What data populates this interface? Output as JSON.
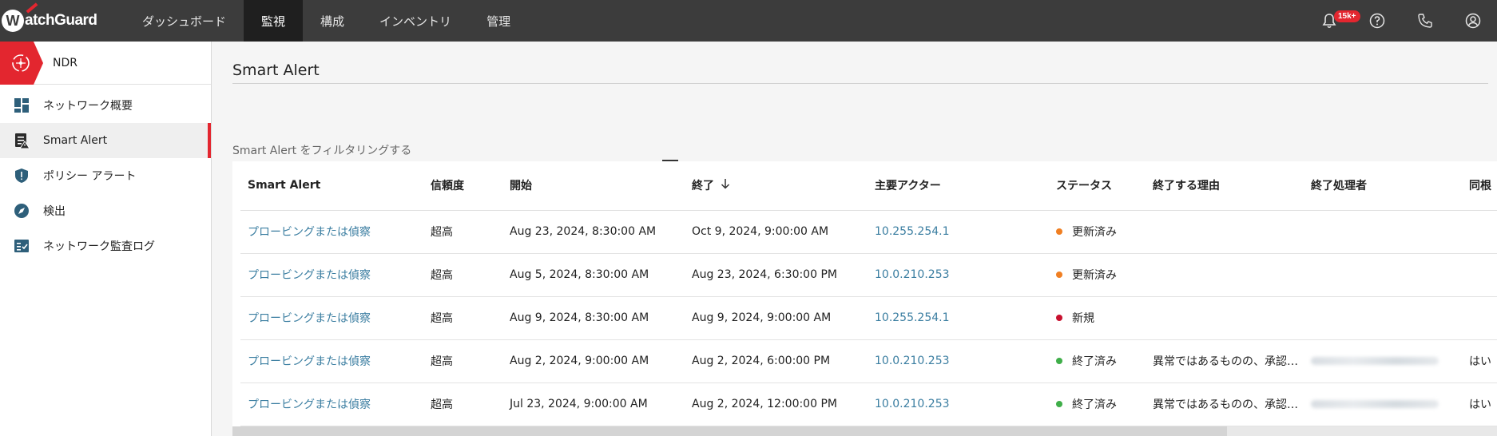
{
  "brand": {
    "logo_letter": "W",
    "logo_text": "atchGuard"
  },
  "nav": [
    {
      "label": "ダッシュボード",
      "active": false
    },
    {
      "label": "監視",
      "active": true
    },
    {
      "label": "構成",
      "active": false
    },
    {
      "label": "インベントリ",
      "active": false
    },
    {
      "label": "管理",
      "active": false
    }
  ],
  "topbar": {
    "notifications_badge": "15k+"
  },
  "sidebar": {
    "header": "NDR",
    "items": [
      {
        "label": "ネットワーク概要",
        "icon": "dashboard-icon",
        "active": false
      },
      {
        "label": "Smart Alert",
        "icon": "alert-list-icon",
        "active": true
      },
      {
        "label": "ポリシー アラート",
        "icon": "shield-icon",
        "active": false
      },
      {
        "label": "検出",
        "icon": "compass-icon",
        "active": false
      },
      {
        "label": "ネットワーク監査ログ",
        "icon": "audit-log-icon",
        "active": false
      }
    ]
  },
  "main": {
    "title": "Smart Alert",
    "filter": {
      "placeholder": "Smart Alert をフィルタリングする"
    }
  },
  "table": {
    "columns": [
      "Smart Alert",
      "信頼度",
      "開始",
      "終了",
      "主要アクター",
      "ステータス",
      "終了する理由",
      "終了処理者",
      "同根"
    ],
    "sort_column": "終了",
    "sort_direction": "desc",
    "rows": [
      {
        "alert": "プロービングまたは偵察",
        "confidence": "超高",
        "start": "Aug 23, 2024, 8:30:00 AM",
        "end": "Oct 9, 2024, 9:00:00 AM",
        "actor": "10.255.254.1",
        "status": "更新済み",
        "status_color": "#f07f22",
        "reason": "",
        "closed_by": "",
        "same_root": ""
      },
      {
        "alert": "プロービングまたは偵察",
        "confidence": "超高",
        "start": "Aug 5, 2024, 8:30:00 AM",
        "end": "Aug 23, 2024, 6:30:00 PM",
        "actor": "10.0.210.253",
        "status": "更新済み",
        "status_color": "#f07f22",
        "reason": "",
        "closed_by": "",
        "same_root": ""
      },
      {
        "alert": "プロービングまたは偵察",
        "confidence": "超高",
        "start": "Aug 9, 2024, 8:30:00 AM",
        "end": "Aug 9, 2024, 9:00:00 AM",
        "actor": "10.255.254.1",
        "status": "新規",
        "status_color": "#c8102e",
        "reason": "",
        "closed_by": "",
        "same_root": ""
      },
      {
        "alert": "プロービングまたは偵察",
        "confidence": "超高",
        "start": "Aug 2, 2024, 9:00:00 AM",
        "end": "Aug 2, 2024, 6:00:00 PM",
        "actor": "10.0.210.253",
        "status": "終了済み",
        "status_color": "#3fae49",
        "reason": "異常ではあるものの、承認…",
        "closed_by": "blurred",
        "same_root": "はい"
      },
      {
        "alert": "プロービングまたは偵察",
        "confidence": "超高",
        "start": "Jul 23, 2024, 9:00:00 AM",
        "end": "Aug 2, 2024, 12:00:00 PM",
        "actor": "10.0.210.253",
        "status": "終了済み",
        "status_color": "#3fae49",
        "reason": "異常ではあるものの、承認…",
        "closed_by": "blurred",
        "same_root": "はい"
      }
    ]
  },
  "colors": {
    "accent": "#e3262f",
    "link": "#3b7ea1",
    "topbar": "#3c3c3c"
  }
}
